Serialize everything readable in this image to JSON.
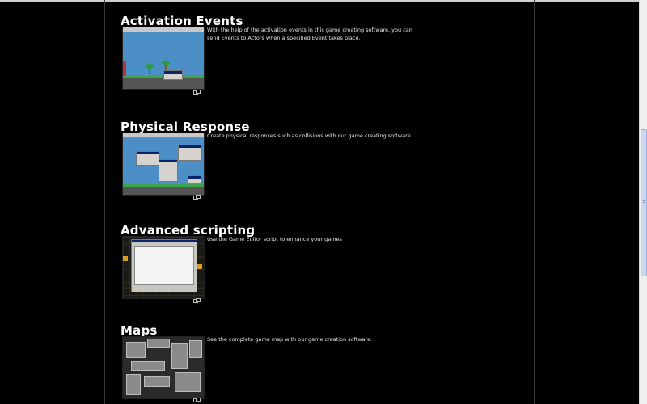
{
  "features": [
    {
      "title": "Activation Events",
      "description": "With the help of the activation events in this game creating software, you can send Events to Actors when a specified Event takes place.",
      "thumbnail": "screenshot-activation-events",
      "enlarge_icon": "enlarge-icon"
    },
    {
      "title": "Physical Response",
      "description": "Create physical responses such as collisions with our game creating software",
      "thumbnail": "screenshot-physical-response",
      "enlarge_icon": "enlarge-icon"
    },
    {
      "title": "Advanced scripting",
      "description": "Use the Game Editor script to enhance your games",
      "thumbnail": "screenshot-advanced-scripting",
      "enlarge_icon": "enlarge-icon"
    },
    {
      "title": "Maps",
      "description": "See the complete game map with our game creation software.",
      "thumbnail": "screenshot-maps",
      "enlarge_icon": "enlarge-icon"
    }
  ],
  "colors": {
    "background": "#000000",
    "text": "#ffffff",
    "column_border": "#3a3a3a",
    "scrollbar_thumb": "#c9d7f0"
  }
}
